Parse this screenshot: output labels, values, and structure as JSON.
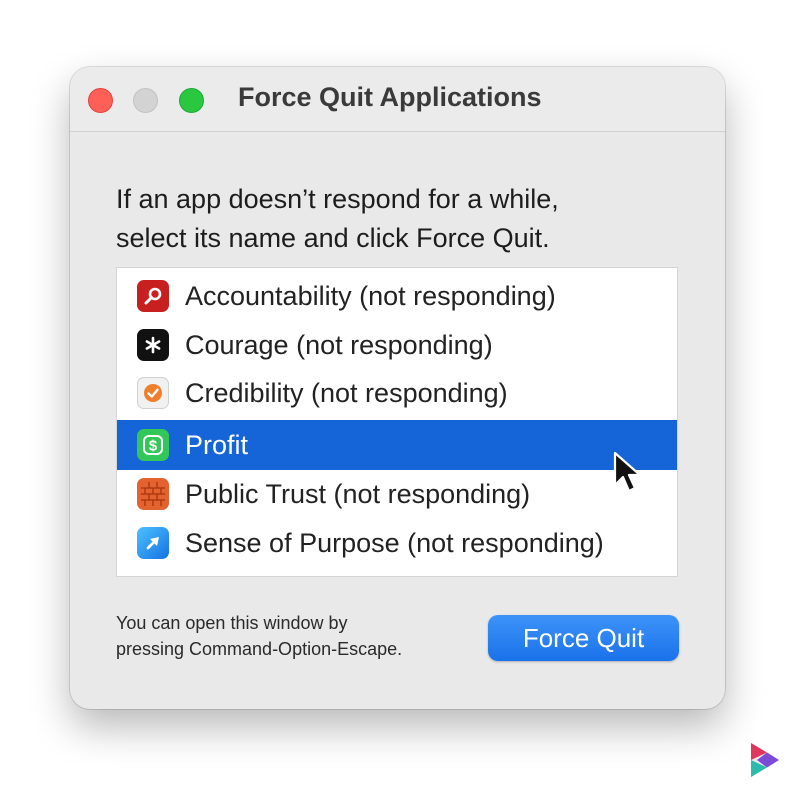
{
  "window": {
    "title": "Force Quit Applications"
  },
  "instructions": {
    "line1": "If an app doesn’t respond for a while,",
    "line2": "select its name and click Force Quit."
  },
  "apps": [
    {
      "label": "Accountability (not responding)",
      "icon": "magnifier-icon",
      "selected": false
    },
    {
      "label": "Courage (not responding)",
      "icon": "asterisk-icon",
      "selected": false
    },
    {
      "label": "Credibility (not responding)",
      "icon": "checkmark-badge-icon",
      "selected": false
    },
    {
      "label": "Profit",
      "icon": "dollar-icon",
      "selected": true
    },
    {
      "label": "Public Trust (not responding)",
      "icon": "brick-wall-icon",
      "selected": false
    },
    {
      "label": "Sense of Purpose (not responding)",
      "icon": "arrow-icon",
      "selected": false
    }
  ],
  "footnote": {
    "line1": "You can open this window by",
    "line2": "pressing Command-Option-Escape."
  },
  "force_quit_button": {
    "label": "Force Quit"
  },
  "colors": {
    "selection": "#1565d8",
    "button": "#1a72ea",
    "close": "#fe5f57",
    "zoom": "#29c840"
  }
}
